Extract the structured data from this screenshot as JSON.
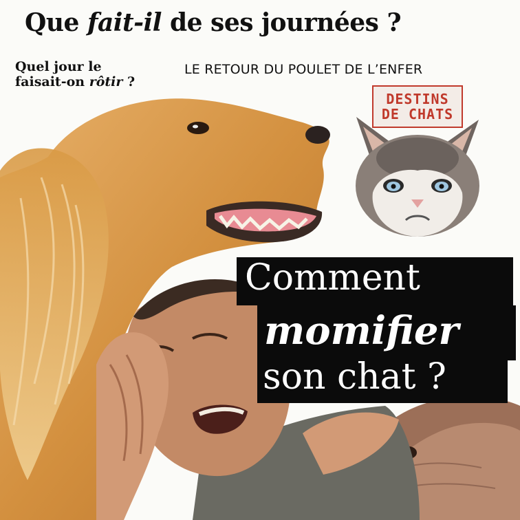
{
  "headline": {
    "pre": "Que ",
    "em": "fait-il",
    "post": " de ses journées ?"
  },
  "question": {
    "line1": "Quel jour le",
    "line2_pre": "faisait-on ",
    "line2_em": "rôtir",
    "line2_post": " ?"
  },
  "retour": "LE RETOUR DU POULET DE L’ENFER",
  "stamp": {
    "line1": "DESTINS",
    "line2": "DE CHATS"
  },
  "comment": {
    "line1": "Comment",
    "line2": "momifier",
    "line3": "son chat ?"
  },
  "colors": {
    "stamp_red": "#c0392b",
    "dog_gold": "#d99a45",
    "box_black": "#0b0b0b"
  }
}
